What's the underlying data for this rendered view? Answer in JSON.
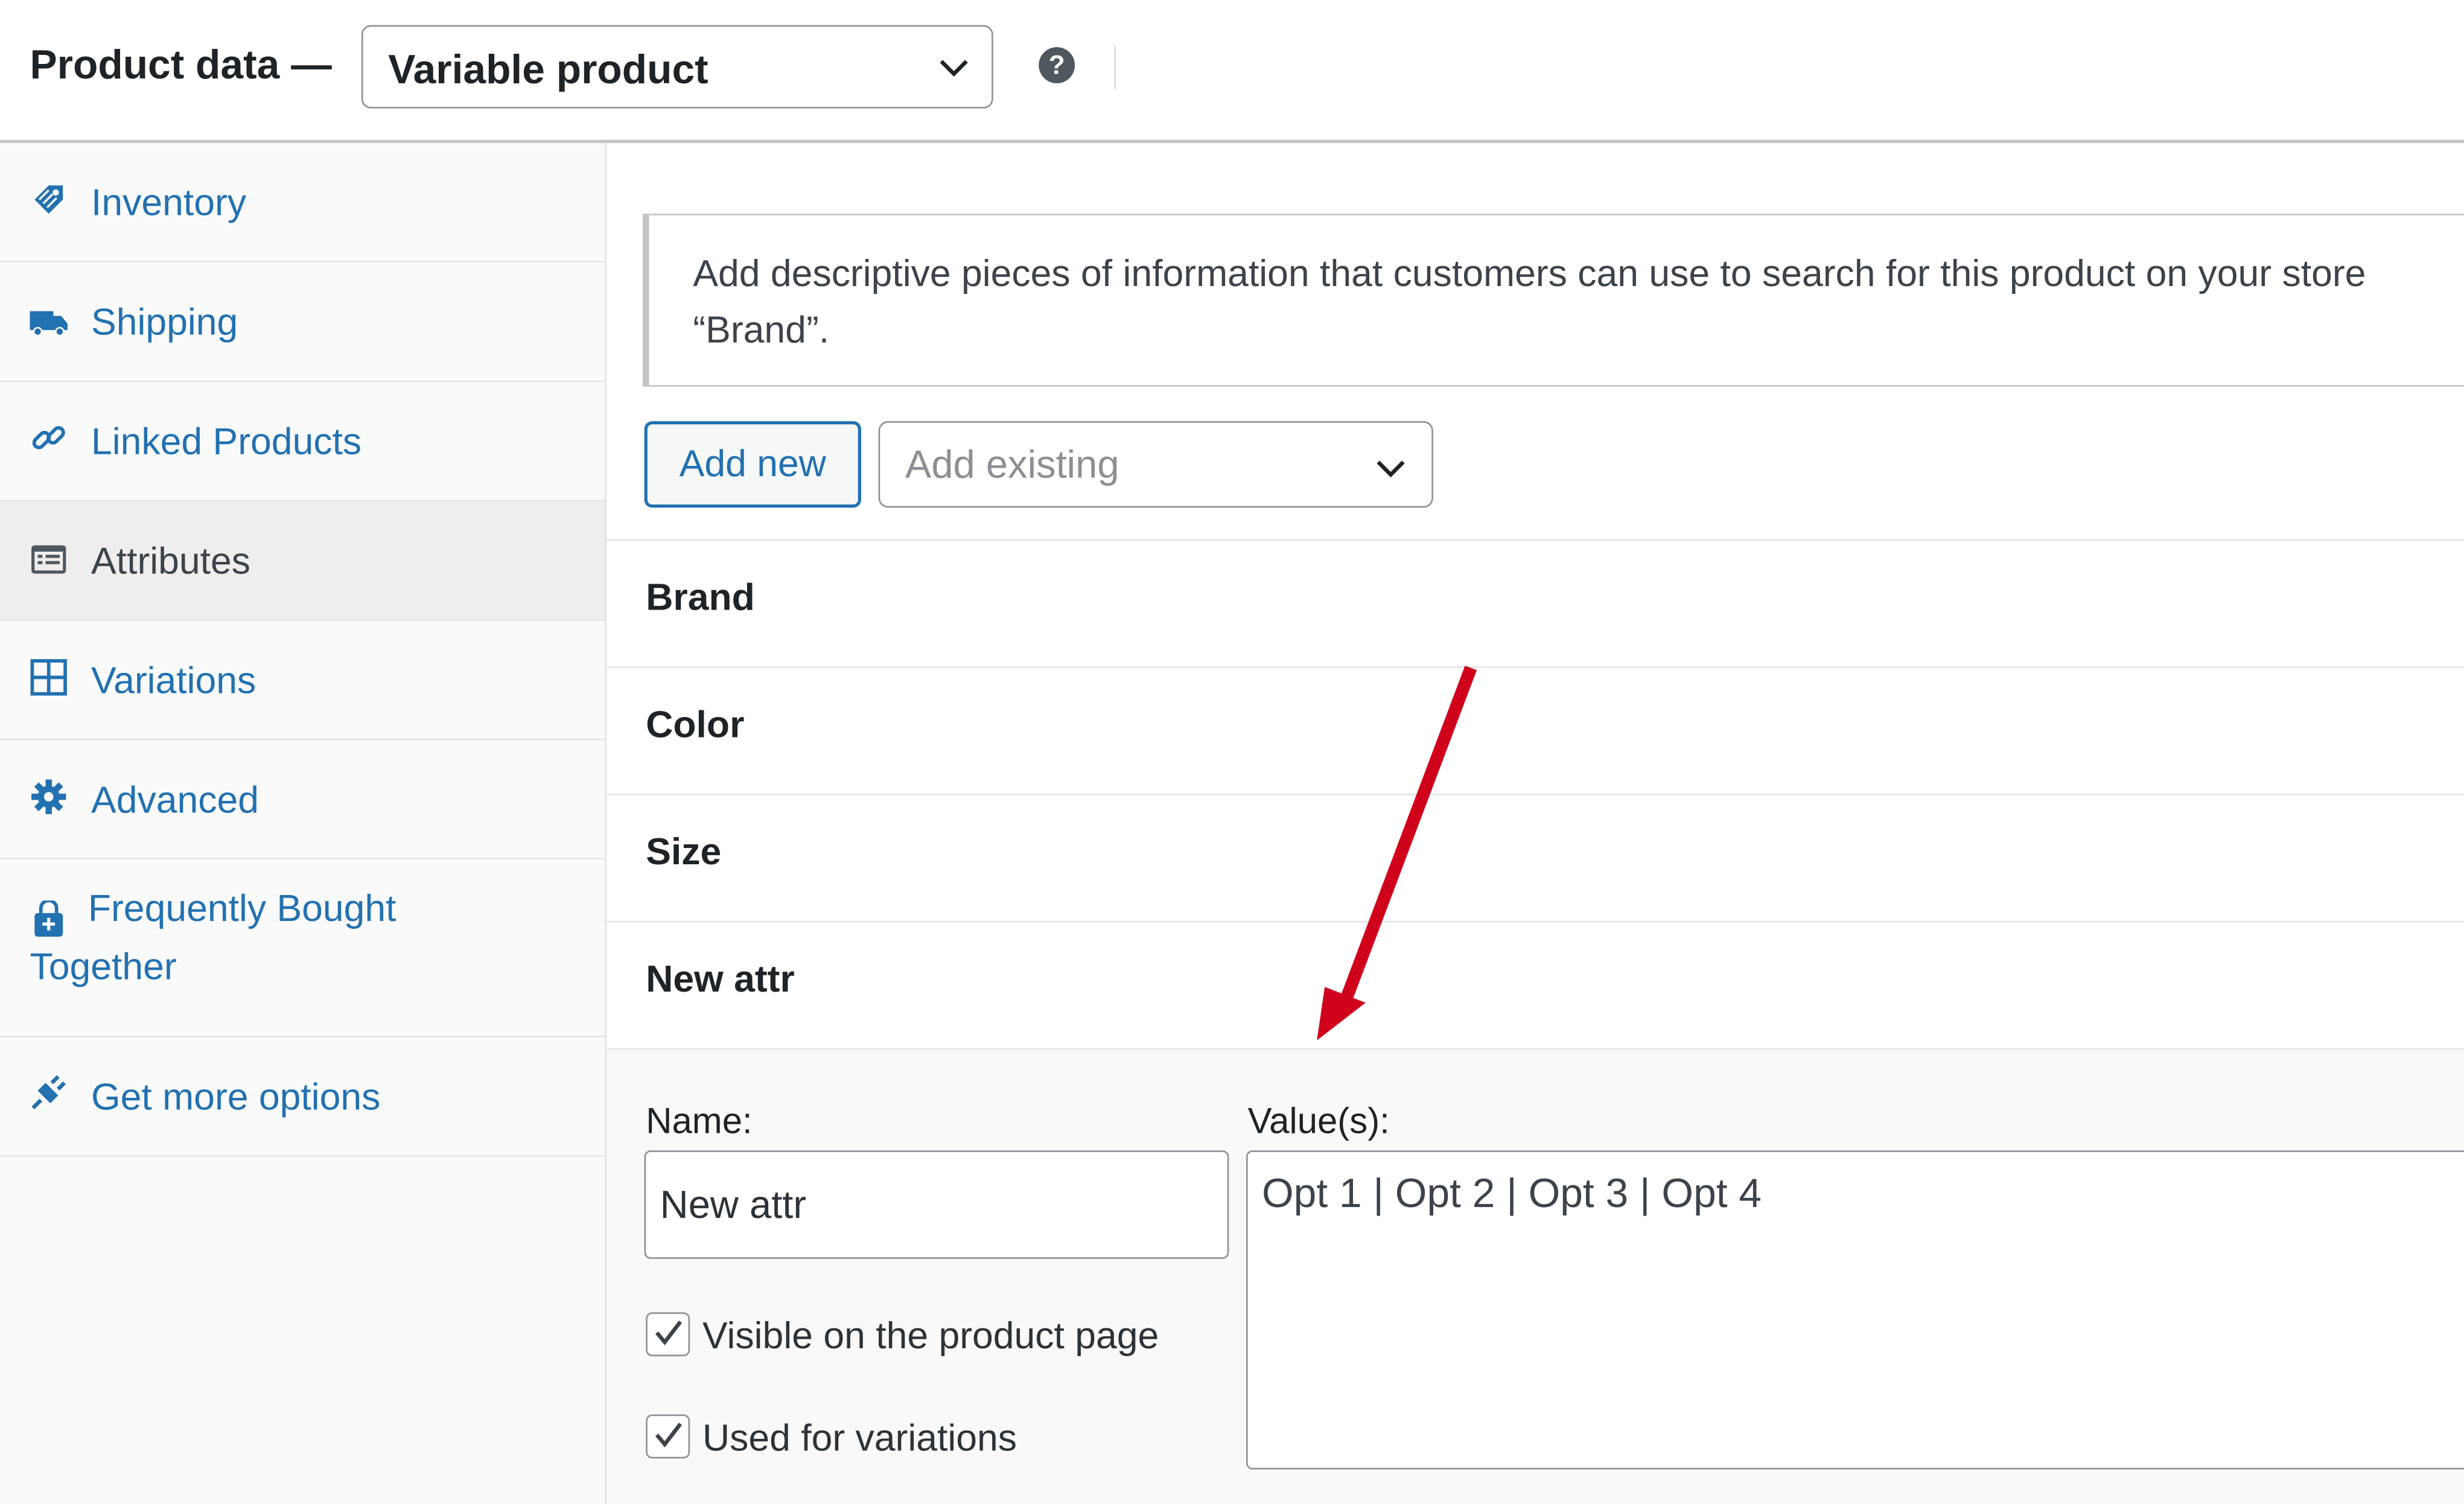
{
  "header": {
    "title": "Product data —",
    "product_type": "Variable product"
  },
  "sidebar": {
    "items": [
      {
        "label": "Inventory",
        "icon": "tag-icon"
      },
      {
        "label": "Shipping",
        "icon": "truck-icon"
      },
      {
        "label": "Linked Products",
        "icon": "link-icon"
      },
      {
        "label": "Attributes",
        "icon": "list-icon",
        "active": true
      },
      {
        "label": "Variations",
        "icon": "grid-icon"
      },
      {
        "label": "Advanced",
        "icon": "gear-icon"
      },
      {
        "label": "Frequently Bought Together",
        "icon": "shopping-bag-icon"
      },
      {
        "label": "Get more options",
        "icon": "plugin-icon"
      }
    ]
  },
  "attributes": {
    "notice": "Add descriptive pieces of information that customers can use to search for this product on your store\n“Brand”.",
    "add_new_label": "Add new",
    "add_existing_placeholder": "Add existing",
    "rows": [
      "Brand",
      "Color",
      "Size",
      "New attr"
    ],
    "editor": {
      "name_label": "Name:",
      "name_value": "New attr",
      "values_label": "Value(s):",
      "values_value": "Opt 1 | Opt 2 | Opt 3 | Opt 4",
      "visible_label": "Visible on the product page",
      "visible_checked": true,
      "variations_label": "Used for variations",
      "variations_checked": true
    }
  },
  "colors": {
    "link": "#2271b1",
    "arrow": "#d0021b"
  }
}
